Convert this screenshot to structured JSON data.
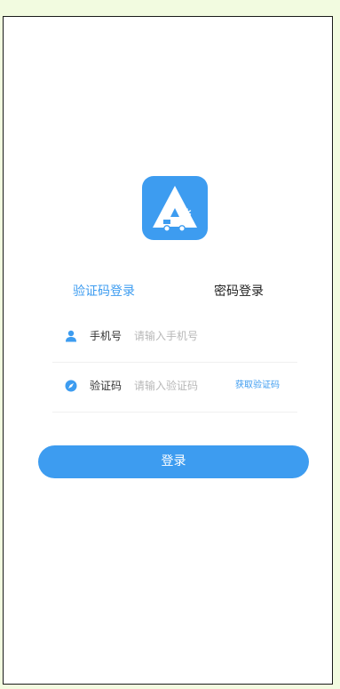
{
  "tabs": {
    "sms_login": "验证码登录",
    "password_login": "密码登录"
  },
  "phone_row": {
    "label": "手机号",
    "placeholder": "请输入手机号",
    "value": "",
    "icon": "user-icon"
  },
  "code_row": {
    "label": "验证码",
    "placeholder": "请输入验证码",
    "value": "",
    "icon": "compass-icon",
    "get_code_label": "获取验证码"
  },
  "login_button": {
    "label": "登录"
  },
  "colors": {
    "accent": "#3d9cf0",
    "page_background": "#f2fbe0",
    "placeholder": "#b8b8b8"
  }
}
